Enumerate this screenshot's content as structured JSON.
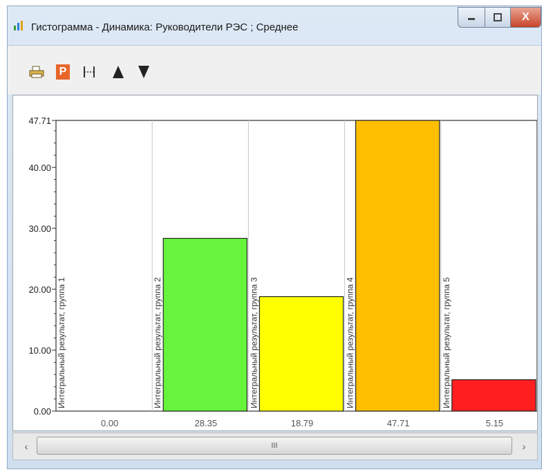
{
  "window": {
    "title": "Гистограмма - Динамика: Руководители РЭС ; Среднее",
    "close_label": "X"
  },
  "toolbar": {
    "buttons": [
      {
        "name": "print-icon"
      },
      {
        "name": "p-icon",
        "label": "P"
      },
      {
        "name": "fit-width-icon"
      },
      {
        "name": "up-triangle-icon"
      },
      {
        "name": "down-triangle-icon"
      }
    ]
  },
  "scrollbar": {
    "thumb_grip": "III"
  },
  "colors": {
    "green": "#66f53c",
    "yellow": "#ffff00",
    "orange": "#ffbf00",
    "red": "#ff1f1f"
  },
  "chart_data": {
    "type": "bar",
    "categories": [
      "Интегральный результат, группа 1",
      "Интегральный результат, группа 2",
      "Интегральный результат, группа 3",
      "Интегральный результат, группа 4",
      "Интегральный результат, группа 5"
    ],
    "values": [
      0.0,
      28.35,
      18.79,
      47.71,
      5.15
    ],
    "value_labels": [
      "0.00",
      "28.35",
      "18.79",
      "47.71",
      "5.15"
    ],
    "bar_colors": [
      "#ffffff",
      "#66f53c",
      "#ffff00",
      "#ffbf00",
      "#ff1f1f"
    ],
    "ylim": [
      0,
      47.71
    ],
    "yticks": [
      0,
      10,
      20,
      30,
      40,
      47.71
    ],
    "ytick_labels": [
      "0.00",
      "10.00",
      "20.00",
      "30.00",
      "40.00",
      "47.71"
    ],
    "grid": false
  }
}
